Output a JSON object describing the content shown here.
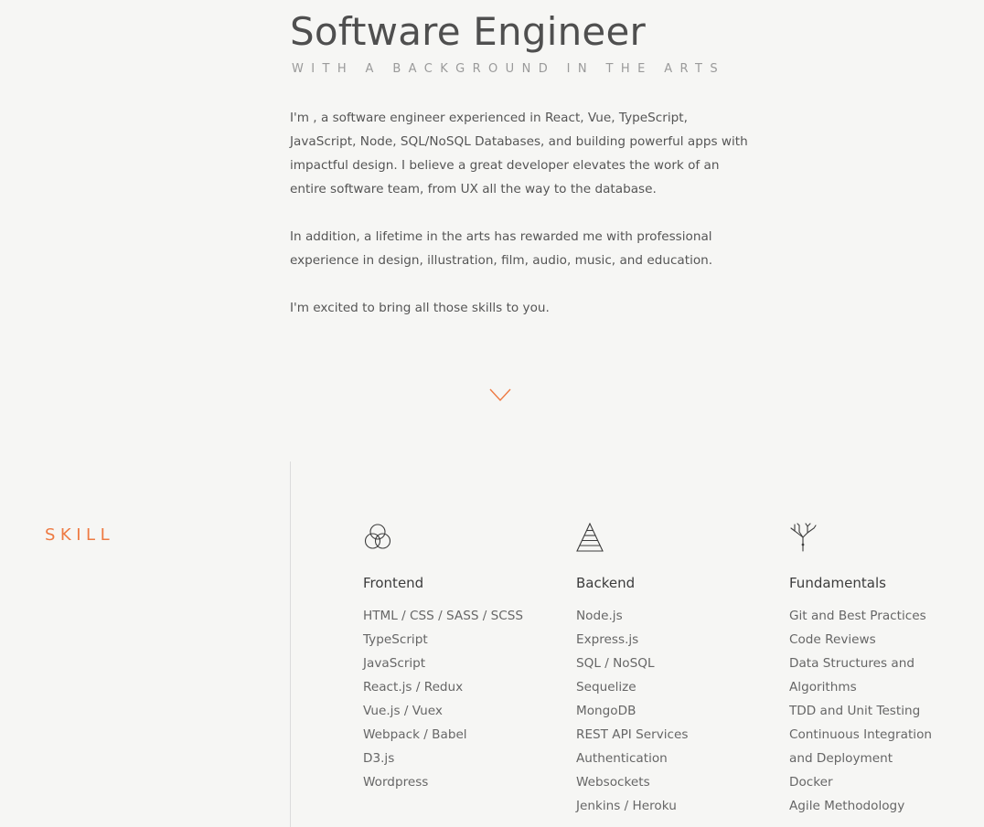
{
  "hero": {
    "title": "Software Engineer",
    "subtitle": "WITH A BACKGROUND IN THE ARTS",
    "paragraphs": [
      "I'm , a software engineer experienced in React, Vue, TypeScript, JavaScript, Node, SQL/NoSQL Databases, and building powerful apps with impactful design. I believe a great developer elevates the work of an entire software team, from UX all the way to the database.",
      "In addition, a lifetime in the arts has rewarded me with professional experience in design, illustration, film, audio, music, and education.",
      "I'm excited to bring all those skills to you."
    ]
  },
  "scroll_icon": "chevron-down-icon",
  "accent_color": "#ee7a42",
  "skills": {
    "label": "SKILL",
    "columns": [
      {
        "icon": "venn-circles-icon",
        "title": "Frontend",
        "items": [
          "HTML / CSS / SASS / SCSS",
          "TypeScript",
          "JavaScript",
          "React.js / Redux",
          "Vue.js / Vuex",
          "Webpack / Babel",
          "D3.js",
          "Wordpress"
        ]
      },
      {
        "icon": "pyramid-icon",
        "title": "Backend",
        "items": [
          "Node.js",
          "Express.js",
          "SQL / NoSQL",
          "Sequelize",
          "MongoDB",
          "REST API Services",
          "Authentication",
          "Websockets",
          "Jenkins / Heroku"
        ]
      },
      {
        "icon": "tree-roots-icon",
        "title": "Fundamentals",
        "items": [
          "Git and Best Practices",
          "Code Reviews",
          "Data Structures and Algorithms",
          "TDD and Unit Testing",
          "Continuous Integration and Deployment",
          "Docker",
          "Agile Methodology"
        ]
      }
    ]
  }
}
